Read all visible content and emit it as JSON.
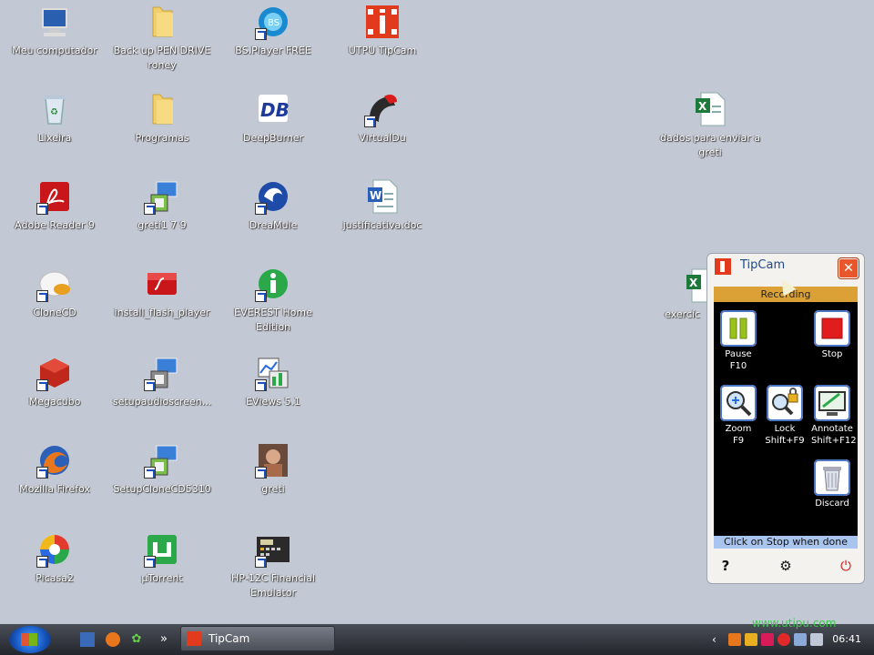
{
  "desktop_icons": [
    {
      "label": "Meu computador"
    },
    {
      "label": "Back up PEN DRIVE roney"
    },
    {
      "label": "BS.Player FREE"
    },
    {
      "label": "UTPU TipCam"
    },
    {
      "label": "Lixeira"
    },
    {
      "label": "Programas"
    },
    {
      "label": "DeepBurner"
    },
    {
      "label": "VirtualDu"
    },
    {
      "label": "dados para enviar a greti"
    },
    {
      "label": "Adobe Reader 9"
    },
    {
      "label": "greti1 7 9"
    },
    {
      "label": "DreaMule"
    },
    {
      "label": "justificativa.doc"
    },
    {
      "label": "CloneCD"
    },
    {
      "label": "install_flash_player"
    },
    {
      "label": "EVEREST Home Edition"
    },
    {
      "label": "exercíc"
    },
    {
      "label": "Megacubo"
    },
    {
      "label": "setupaudioscreen..."
    },
    {
      "label": "EViews 5.1"
    },
    {
      "label": "Mozilla Firefox"
    },
    {
      "label": "SetupCloneCD5310"
    },
    {
      "label": "greti"
    },
    {
      "label": "Picasa2"
    },
    {
      "label": "µTorrent"
    },
    {
      "label": "HP-12C Financial Emulator"
    }
  ],
  "tipcam": {
    "title": "TipCam",
    "status": "Recording",
    "buttons": {
      "pause": {
        "label": "Pause",
        "shortcut": "F10"
      },
      "stop": {
        "label": "Stop"
      },
      "zoom": {
        "label": "Zoom",
        "shortcut": "F9"
      },
      "lock": {
        "label": "Lock",
        "shortcut": "Shift+F9"
      },
      "annotate": {
        "label": "Annotate",
        "shortcut": "Shift+F12"
      },
      "discard": {
        "label": "Discard"
      }
    },
    "footer": "Click on Stop when done"
  },
  "taskbar": {
    "task_label": "TipCam",
    "clock": "06:41",
    "watermark": "www.utipu.com"
  },
  "colors": {
    "desktop": "#c3c9d4",
    "status_bar": "#dba136",
    "footer_bar": "#a9c5ef",
    "close_button": "#e7572b"
  }
}
